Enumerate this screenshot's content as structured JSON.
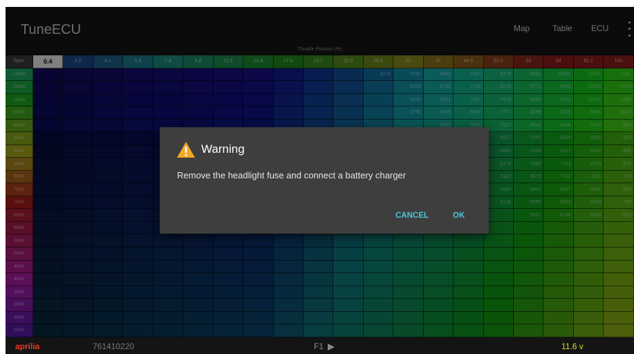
{
  "app_bar": {
    "title": "TuneECU",
    "menu": [
      "Map",
      "Table",
      "ECU"
    ]
  },
  "table": {
    "axis_title": "Throttle Position (%)",
    "corner_label": "Rpm",
    "column_headers": [
      "0.4",
      "2.0",
      "4.1",
      "5.9",
      "7.8",
      "9.8",
      "12.2",
      "14.9",
      "17.6",
      "19.7",
      "22.0",
      "26.5",
      "30",
      "37",
      "44.5",
      "52.0",
      "59",
      "69",
      "82.1",
      "100"
    ],
    "row_headers": [
      "12000",
      "11500",
      "11000",
      "10500",
      "10000",
      "9500",
      "9000",
      "8500",
      "8000",
      "7500",
      "7000",
      "6500",
      "6000",
      "5500",
      "5000",
      "4500",
      "4000",
      "3500",
      "3000",
      "2500",
      "2000",
      "1750",
      "1500",
      "0"
    ],
    "visible_values": {
      "row0": [
        "6171",
        "6790",
        "6980",
        "7304",
        "8379",
        "9061",
        "10390",
        "10267",
        "1041"
      ],
      "row1": [
        "6389",
        "6710",
        "7256",
        "8226",
        "8771",
        "9583",
        "10159",
        "1024"
      ],
      "row2": [
        "6605",
        "6612",
        "7167",
        "7978",
        "8563",
        "9591",
        "10162",
        "1050"
      ],
      "row3": [
        "5790",
        "6426",
        "6982",
        "7707",
        "8298",
        "9228",
        "9665",
        "1007"
      ],
      "row4": [
        "6000",
        "6325",
        "7527",
        "8040",
        "8606",
        "9140",
        "924"
      ],
      "row5": [
        "8221",
        "7642",
        "8349",
        "8936",
        "926"
      ],
      "row6": [
        "6845",
        "7478",
        "8127",
        "9047",
        "906"
      ],
      "row7": [
        "6478",
        "7083",
        "7749",
        "8513",
        "916"
      ],
      "row8": [
        "6142",
        "6675",
        "7332",
        "7901",
        "765"
      ],
      "row9": [
        "5580",
        "6001",
        "6927",
        "6957",
        "800"
      ],
      "row10": [
        "5128",
        "5690",
        "6015",
        "6520",
        "718"
      ],
      "row11": [
        "5651",
        "6146",
        "6038",
        "693"
      ]
    }
  },
  "dialog": {
    "title": "Warning",
    "message": "Remove the headlight fuse and connect a battery charger",
    "cancel_label": "CANCEL",
    "ok_label": "OK"
  },
  "status_bar": {
    "brand": "aprilia",
    "ecu_id": "761410220",
    "map_label": "F1",
    "voltage": "11.6 v"
  },
  "colors": {
    "accent": "#4ec3d9",
    "warning": "#f5a623",
    "brand": "#e03a2a",
    "voltage": "#d4dc24"
  }
}
